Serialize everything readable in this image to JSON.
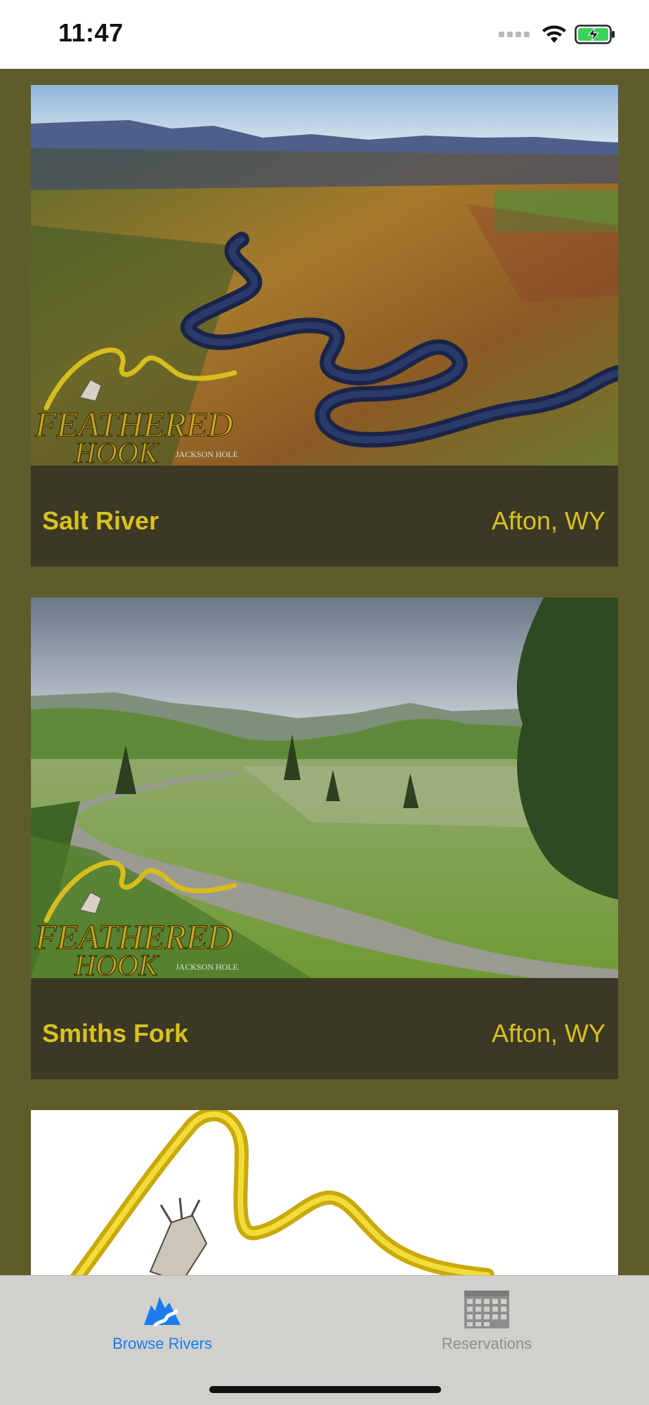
{
  "status_bar": {
    "time": "11:47"
  },
  "rivers": [
    {
      "name": "Salt River",
      "location": "Afton, WY"
    },
    {
      "name": "Smiths Fork",
      "location": "Afton, WY"
    }
  ],
  "logo": {
    "line1": "FEATHERED",
    "line2": "HOOK",
    "tagline": "JACKSON HOLE"
  },
  "tabs": [
    {
      "label": "Browse Rivers",
      "icon": "river-mountains-icon",
      "active": true,
      "color": "#1a7cf0"
    },
    {
      "label": "Reservations",
      "icon": "calendar-icon",
      "active": false,
      "color": "#8e8e8e"
    }
  ],
  "colors": {
    "background": "#5f5c2c",
    "card_footer": "#3c3826",
    "accent": "#d8c21d"
  }
}
